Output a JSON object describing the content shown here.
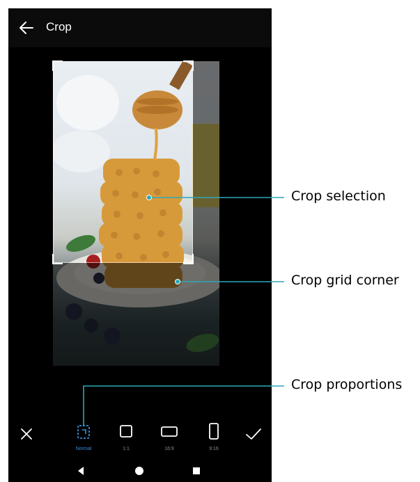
{
  "titlebar": {
    "title": "Crop"
  },
  "toolbar": {
    "ratios": [
      {
        "label": "Normal",
        "active": true
      },
      {
        "label": "1:1",
        "active": false
      },
      {
        "label": "16:9",
        "active": false
      },
      {
        "label": "9:16",
        "active": false
      }
    ]
  },
  "callouts": {
    "crop_selection": "Crop selection",
    "crop_grid_corner": "Crop grid corner",
    "crop_proportions": "Crop proportions"
  },
  "colors": {
    "accent": "#3a8fd9",
    "callout_line": "#2aa9b8"
  },
  "icons": {
    "back": "arrow-left-icon",
    "cancel": "close-icon",
    "confirm": "check-icon",
    "nav_back": "triangle-back-icon",
    "nav_home": "circle-home-icon",
    "nav_recent": "square-recent-icon"
  }
}
